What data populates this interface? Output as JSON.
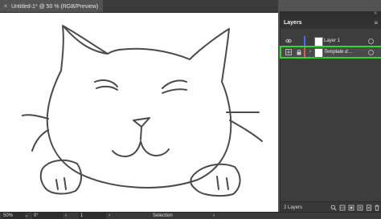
{
  "document": {
    "tab_title": "Untitled-1* @ 50 % (RGB/Preview)",
    "close_label": "×"
  },
  "layers_panel": {
    "title": "Layers",
    "collapse_glyph": "»",
    "menu_glyph": "≡",
    "layers": [
      {
        "name": "Layer 1",
        "color": "#4f6bff",
        "visible": true,
        "template": false
      },
      {
        "name": "Template d…",
        "color": "#e05757",
        "visible": true,
        "template": true,
        "expand_glyph": "›"
      }
    ],
    "count": "2 Layers",
    "footer_icons": [
      "search-icon",
      "locate-object-icon",
      "make-clipping-mask-icon",
      "new-sublayer-icon",
      "new-layer-icon",
      "trash-icon"
    ]
  },
  "status_bar": {
    "zoom": "50%",
    "rotation": "0°",
    "artboard_number": "1",
    "tool": "Selection"
  },
  "colors": {
    "highlight": "#39d52f",
    "ui_bg": "#535353",
    "panel_bg": "#3d3d3d"
  }
}
